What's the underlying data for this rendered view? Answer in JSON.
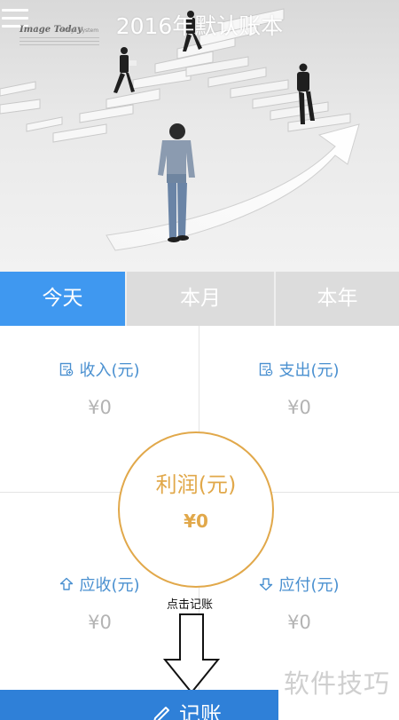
{
  "header": {
    "title": "2016年默认账本",
    "watermark_title": "Image Today",
    "watermark_sub": "Image System"
  },
  "tabs": [
    {
      "label": "今天",
      "active": true
    },
    {
      "label": "本月",
      "active": false
    },
    {
      "label": "本年",
      "active": false
    }
  ],
  "stats": {
    "income": {
      "label": "收入(元)",
      "value": "¥0",
      "icon": "income-icon"
    },
    "expense": {
      "label": "支出(元)",
      "value": "¥0",
      "icon": "expense-icon"
    },
    "profit": {
      "label": "利润(元)",
      "value": "¥0"
    },
    "receivable": {
      "label": "应收(元)",
      "value": "¥0",
      "icon": "receivable-icon"
    },
    "payable": {
      "label": "应付(元)",
      "value": "¥0",
      "icon": "payable-icon"
    }
  },
  "annotation": "点击记账",
  "record_button": {
    "label": "记账",
    "icon": "pen-icon"
  },
  "site_watermark": "软件技巧",
  "colors": {
    "accent_blue": "#3f98f0",
    "label_blue": "#4a90d0",
    "profit_gold": "#e1a84a",
    "value_gray": "#b3b3b3",
    "button_blue": "#2f80d8"
  }
}
